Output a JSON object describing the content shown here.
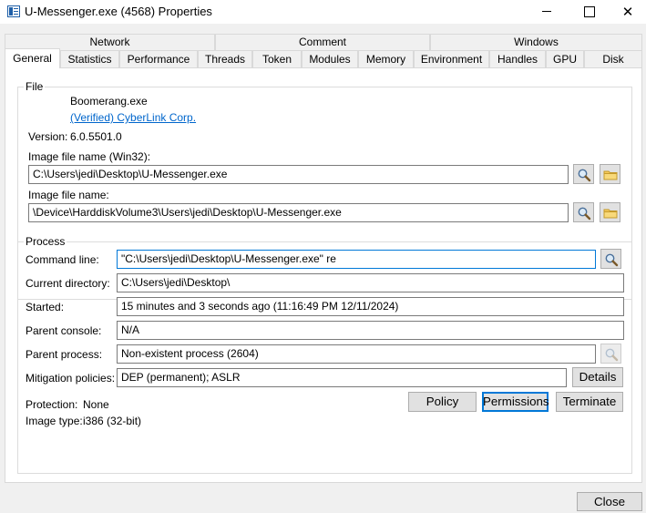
{
  "window": {
    "title": "U-Messenger.exe (4568) Properties",
    "close_glyph": "✕"
  },
  "tabs_row1": [
    "Network",
    "Comment",
    "Windows"
  ],
  "tabs_row2": [
    "General",
    "Statistics",
    "Performance",
    "Threads",
    "Token",
    "Modules",
    "Memory",
    "Environment",
    "Handles",
    "GPU",
    "Disk"
  ],
  "active_tab": "General",
  "file": {
    "group_label": "File",
    "name": "Boomerang.exe",
    "publisher": "(Verified) CyberLink Corp.",
    "version_label": "Version:",
    "version_value": "6.0.5501.0",
    "image_win32_label": "Image file name (Win32):",
    "image_win32_value": "C:\\Users\\jedi\\Desktop\\U-Messenger.exe",
    "image_label": "Image file name:",
    "image_value": "\\Device\\HarddiskVolume3\\Users\\jedi\\Desktop\\U-Messenger.exe"
  },
  "process": {
    "group_label": "Process",
    "command_line_label": "Command line:",
    "command_line_value": "\"C:\\Users\\jedi\\Desktop\\U-Messenger.exe\" re",
    "current_directory_label": "Current directory:",
    "current_directory_value": "C:\\Users\\jedi\\Desktop\\",
    "started_label": "Started:",
    "started_value": "15 minutes and 3 seconds ago (11:16:49 PM 12/11/2024)",
    "parent_console_label": "Parent console:",
    "parent_console_value": "N/A",
    "parent_process_label": "Parent process:",
    "parent_process_value": "Non-existent process (2604)",
    "mitigation_label": "Mitigation policies:",
    "mitigation_value": "DEP (permanent); ASLR",
    "details_button": "Details",
    "protection_label": "Protection:",
    "protection_value": "None",
    "image_type_label": "Image type:",
    "image_type_value": "i386 (32-bit)",
    "policy_button": "Policy",
    "permissions_button": "Permissions",
    "terminate_button": "Terminate"
  },
  "footer": {
    "close_button": "Close"
  },
  "icons": {
    "search": "search-icon",
    "folder": "folder-icon"
  },
  "colors": {
    "link": "#0066cc",
    "focus_border": "#0078d7",
    "title_icon": "#1e5fa8"
  }
}
